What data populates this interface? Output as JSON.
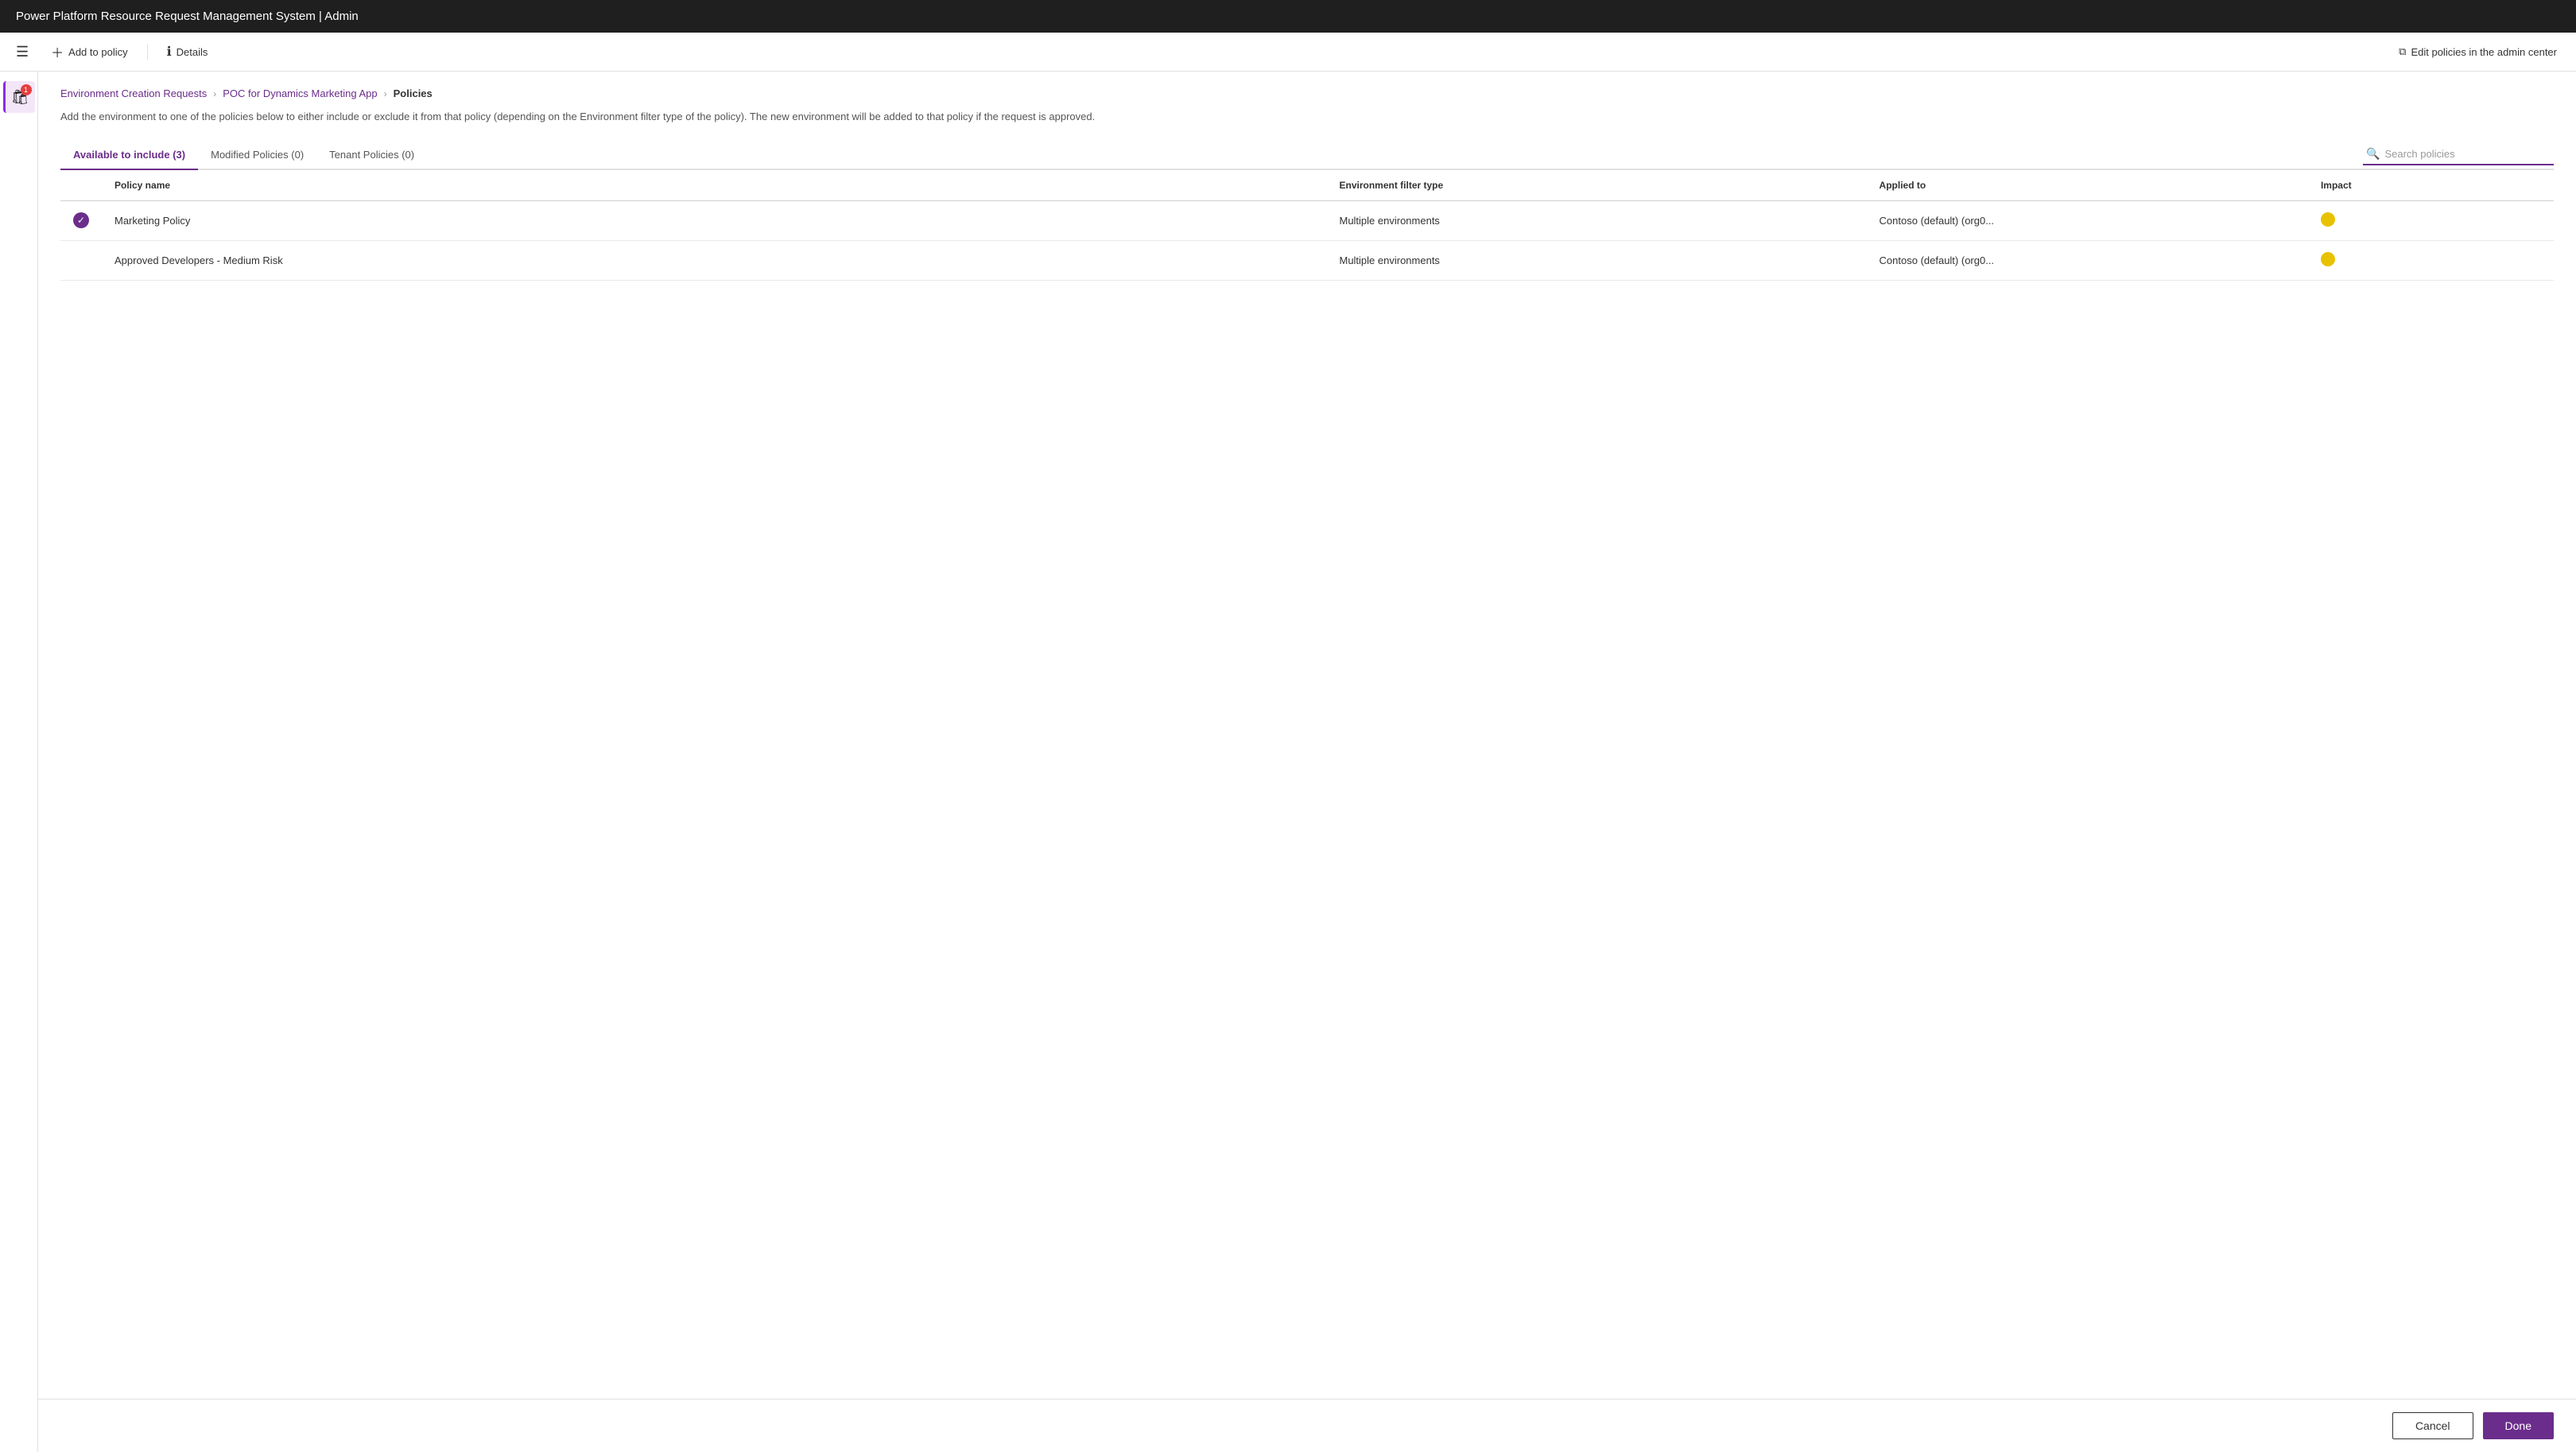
{
  "app": {
    "title": "Power Platform Resource Request Management System | Admin"
  },
  "toolbar": {
    "add_to_policy_label": "Add to policy",
    "details_label": "Details",
    "edit_policies_label": "Edit policies in the admin center"
  },
  "breadcrumb": {
    "step1": "Environment Creation Requests",
    "step2": "POC for Dynamics Marketing App",
    "step3": "Policies"
  },
  "description": "Add the environment to one of the policies below to either include or exclude it from that policy (depending on the Environment filter type of the policy). The new environment will be added to that policy if the request is approved.",
  "tabs": [
    {
      "label": "Available to include (3)",
      "active": true
    },
    {
      "label": "Modified Policies (0)",
      "active": false
    },
    {
      "label": "Tenant Policies (0)",
      "active": false
    }
  ],
  "search": {
    "placeholder": "Search policies"
  },
  "table": {
    "columns": [
      {
        "key": "check",
        "label": ""
      },
      {
        "key": "policy_name",
        "label": "Policy name"
      },
      {
        "key": "env_filter",
        "label": "Environment filter type"
      },
      {
        "key": "applied_to",
        "label": "Applied to"
      },
      {
        "key": "impact",
        "label": "Impact"
      }
    ],
    "rows": [
      {
        "selected": true,
        "policy_name": "Marketing Policy",
        "env_filter": "Multiple environments",
        "applied_to": "Contoso (default) (org0...",
        "impact_color": "yellow"
      },
      {
        "selected": false,
        "policy_name": "Approved Developers - Medium Risk",
        "env_filter": "Multiple environments",
        "applied_to": "Contoso (default) (org0...",
        "impact_color": "yellow"
      }
    ]
  },
  "footer": {
    "cancel_label": "Cancel",
    "done_label": "Done"
  },
  "nav": {
    "badge_count": "1"
  }
}
